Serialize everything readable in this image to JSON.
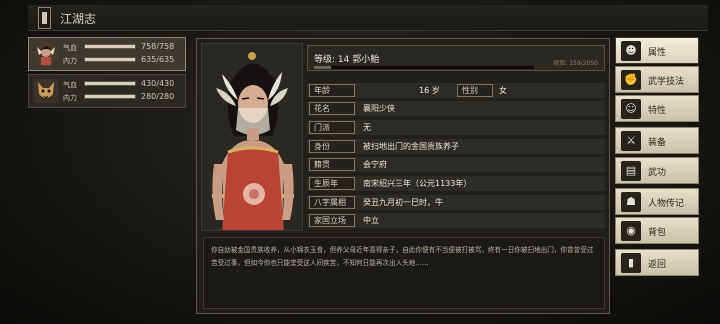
{
  "title": "江湖志",
  "party": [
    {
      "hp_label": "气血",
      "hp": "758/758",
      "hp_fill": 1.0,
      "mp_label": "内力",
      "mp": "635/635",
      "mp_fill": 1.0
    },
    {
      "hp_label": "气血",
      "hp": "430/430",
      "hp_fill": 1.0,
      "mp_label": "内力",
      "mp": "280/280",
      "mp_fill": 1.0
    }
  ],
  "character": {
    "level_text": "等级: 14  郭小鲐",
    "exp_text": "经验: 159/2050",
    "exp_fraction": 0.078,
    "fields": [
      {
        "label": "年龄",
        "value": "16 岁",
        "extra_label": "性别",
        "extra_value": "女"
      },
      {
        "label": "花名",
        "value": "襄阳少侠"
      },
      {
        "label": "门派",
        "value": "无"
      },
      {
        "label": "身份",
        "value": "被扫地出门的金国贵族养子"
      },
      {
        "label": "籍贯",
        "value": "会宁府"
      },
      {
        "label": "生辰年",
        "value": "南宋绍兴三年（公元1133年）"
      },
      {
        "label": "八字属相",
        "value": "癸丑九月初一巳时，牛"
      },
      {
        "label": "家国立场",
        "value": "中立"
      }
    ],
    "description": "你自幼被金国贵族收养，从小锦衣玉食，但养父母近年喜得亲子，自此你便有不当便被打被骂，终有一日你被扫地出门，你曾曾受过苦受过事，但如今你也只能堂受这人间疾苦，不知何日能再次出人头地……"
  },
  "menu": [
    {
      "label": "属性",
      "icon": "person-icon",
      "glyph": "☻"
    },
    {
      "label": "武学技法",
      "icon": "martial-icon",
      "glyph": "✊"
    },
    {
      "label": "特性",
      "icon": "trait-icon",
      "glyph": "☺"
    },
    {
      "label": "装备",
      "icon": "sword-icon",
      "glyph": "⚔"
    },
    {
      "label": "武功",
      "icon": "kungfu-icon",
      "glyph": "▤"
    },
    {
      "label": "人物传记",
      "icon": "biography-icon",
      "glyph": "☗"
    },
    {
      "label": "背包",
      "icon": "bag-icon",
      "glyph": "◉"
    },
    {
      "label": "返回",
      "icon": "return-icon",
      "glyph": "▮"
    }
  ]
}
